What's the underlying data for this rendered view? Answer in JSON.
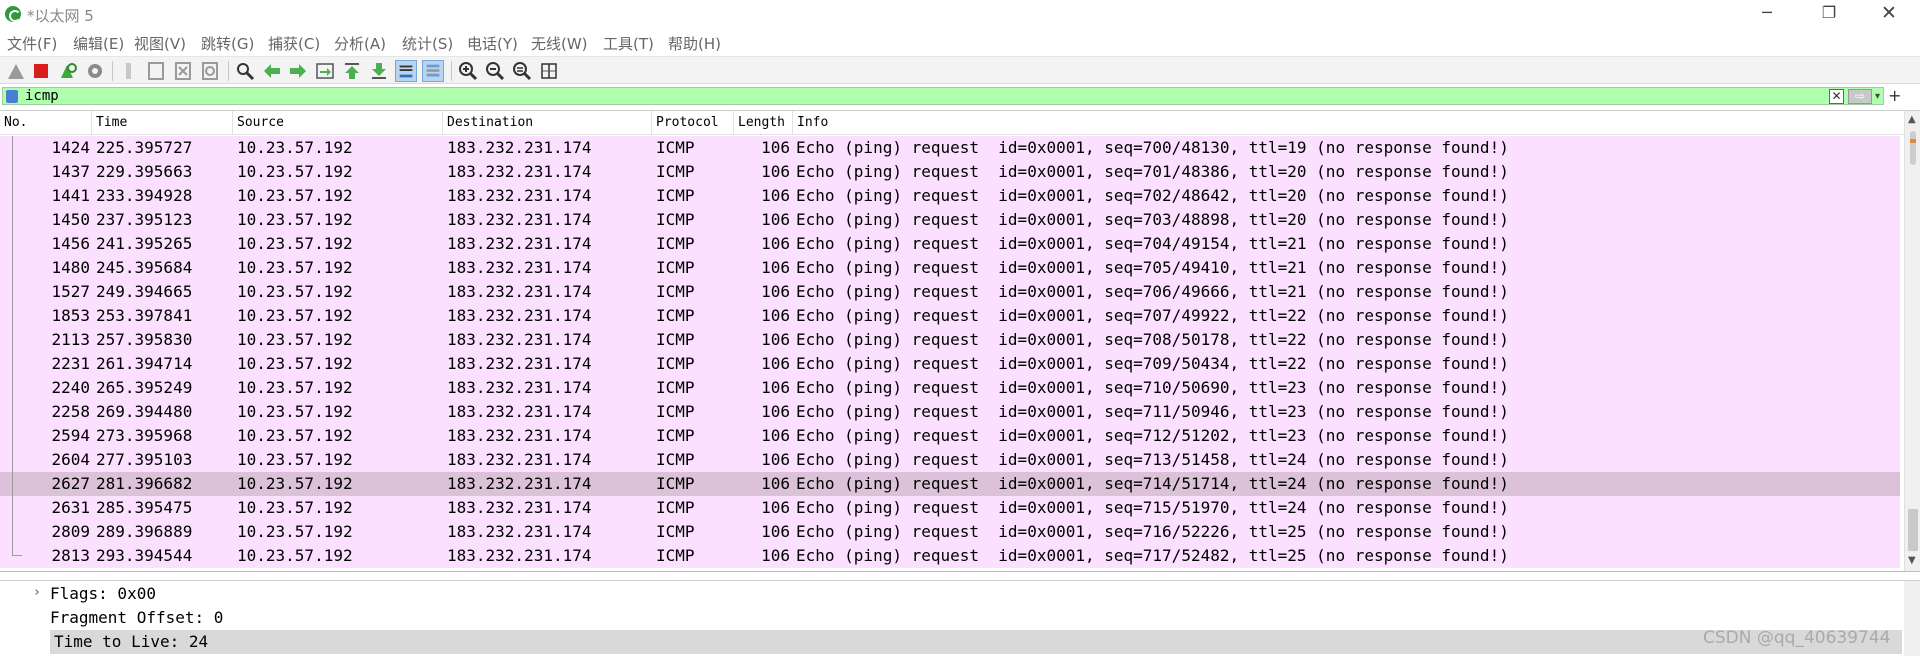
{
  "window": {
    "title": "*以太网 5",
    "minimize": "─",
    "maximize": "❐",
    "close": "✕"
  },
  "menu": [
    "文件(F)",
    "编辑(E)",
    "视图(V)",
    "跳转(G)",
    "捕获(C)",
    "分析(A)",
    "统计(S)",
    "电话(Y)",
    "无线(W)",
    "工具(T)",
    "帮助(H)"
  ],
  "filter": {
    "value": "icmp",
    "clear": "✕",
    "apply": "⇨"
  },
  "columns": [
    "No.",
    "Time",
    "Source",
    "Destination",
    "Protocol",
    "Length",
    "Info"
  ],
  "packets": [
    {
      "no": "1424",
      "time": "225.395727",
      "src": "10.23.57.192",
      "dst": "183.232.231.174",
      "proto": "ICMP",
      "len": "106",
      "info": "Echo (ping) request  id=0x0001, seq=700/48130, ttl=19 (no response found!)"
    },
    {
      "no": "1437",
      "time": "229.395663",
      "src": "10.23.57.192",
      "dst": "183.232.231.174",
      "proto": "ICMP",
      "len": "106",
      "info": "Echo (ping) request  id=0x0001, seq=701/48386, ttl=20 (no response found!)"
    },
    {
      "no": "1441",
      "time": "233.394928",
      "src": "10.23.57.192",
      "dst": "183.232.231.174",
      "proto": "ICMP",
      "len": "106",
      "info": "Echo (ping) request  id=0x0001, seq=702/48642, ttl=20 (no response found!)"
    },
    {
      "no": "1450",
      "time": "237.395123",
      "src": "10.23.57.192",
      "dst": "183.232.231.174",
      "proto": "ICMP",
      "len": "106",
      "info": "Echo (ping) request  id=0x0001, seq=703/48898, ttl=20 (no response found!)"
    },
    {
      "no": "1456",
      "time": "241.395265",
      "src": "10.23.57.192",
      "dst": "183.232.231.174",
      "proto": "ICMP",
      "len": "106",
      "info": "Echo (ping) request  id=0x0001, seq=704/49154, ttl=21 (no response found!)"
    },
    {
      "no": "1480",
      "time": "245.395684",
      "src": "10.23.57.192",
      "dst": "183.232.231.174",
      "proto": "ICMP",
      "len": "106",
      "info": "Echo (ping) request  id=0x0001, seq=705/49410, ttl=21 (no response found!)"
    },
    {
      "no": "1527",
      "time": "249.394665",
      "src": "10.23.57.192",
      "dst": "183.232.231.174",
      "proto": "ICMP",
      "len": "106",
      "info": "Echo (ping) request  id=0x0001, seq=706/49666, ttl=21 (no response found!)"
    },
    {
      "no": "1853",
      "time": "253.397841",
      "src": "10.23.57.192",
      "dst": "183.232.231.174",
      "proto": "ICMP",
      "len": "106",
      "info": "Echo (ping) request  id=0x0001, seq=707/49922, ttl=22 (no response found!)"
    },
    {
      "no": "2113",
      "time": "257.395830",
      "src": "10.23.57.192",
      "dst": "183.232.231.174",
      "proto": "ICMP",
      "len": "106",
      "info": "Echo (ping) request  id=0x0001, seq=708/50178, ttl=22 (no response found!)"
    },
    {
      "no": "2231",
      "time": "261.394714",
      "src": "10.23.57.192",
      "dst": "183.232.231.174",
      "proto": "ICMP",
      "len": "106",
      "info": "Echo (ping) request  id=0x0001, seq=709/50434, ttl=22 (no response found!)"
    },
    {
      "no": "2240",
      "time": "265.395249",
      "src": "10.23.57.192",
      "dst": "183.232.231.174",
      "proto": "ICMP",
      "len": "106",
      "info": "Echo (ping) request  id=0x0001, seq=710/50690, ttl=23 (no response found!)"
    },
    {
      "no": "2258",
      "time": "269.394480",
      "src": "10.23.57.192",
      "dst": "183.232.231.174",
      "proto": "ICMP",
      "len": "106",
      "info": "Echo (ping) request  id=0x0001, seq=711/50946, ttl=23 (no response found!)"
    },
    {
      "no": "2594",
      "time": "273.395968",
      "src": "10.23.57.192",
      "dst": "183.232.231.174",
      "proto": "ICMP",
      "len": "106",
      "info": "Echo (ping) request  id=0x0001, seq=712/51202, ttl=23 (no response found!)"
    },
    {
      "no": "2604",
      "time": "277.395103",
      "src": "10.23.57.192",
      "dst": "183.232.231.174",
      "proto": "ICMP",
      "len": "106",
      "info": "Echo (ping) request  id=0x0001, seq=713/51458, ttl=24 (no response found!)"
    },
    {
      "no": "2627",
      "time": "281.396682",
      "src": "10.23.57.192",
      "dst": "183.232.231.174",
      "proto": "ICMP",
      "len": "106",
      "info": "Echo (ping) request  id=0x0001, seq=714/51714, ttl=24 (no response found!)",
      "selected": true
    },
    {
      "no": "2631",
      "time": "285.395475",
      "src": "10.23.57.192",
      "dst": "183.232.231.174",
      "proto": "ICMP",
      "len": "106",
      "info": "Echo (ping) request  id=0x0001, seq=715/51970, ttl=24 (no response found!)"
    },
    {
      "no": "2809",
      "time": "289.396889",
      "src": "10.23.57.192",
      "dst": "183.232.231.174",
      "proto": "ICMP",
      "len": "106",
      "info": "Echo (ping) request  id=0x0001, seq=716/52226, ttl=25 (no response found!)"
    },
    {
      "no": "2813",
      "time": "293.394544",
      "src": "10.23.57.192",
      "dst": "183.232.231.174",
      "proto": "ICMP",
      "len": "106",
      "info": "Echo (ping) request  id=0x0001, seq=717/52482, ttl=25 (no response found!)"
    }
  ],
  "details": {
    "flags": "Flags: 0x00",
    "fragment_offset": "Fragment Offset: 0",
    "ttl": "Time to Live: 24",
    "expander": "›"
  },
  "watermark": "CSDN @qq_40639744",
  "colors": {
    "packet_row": "#fce0ff",
    "selected_row": "#dbc2d9",
    "filter_bg": "#afffaf"
  }
}
